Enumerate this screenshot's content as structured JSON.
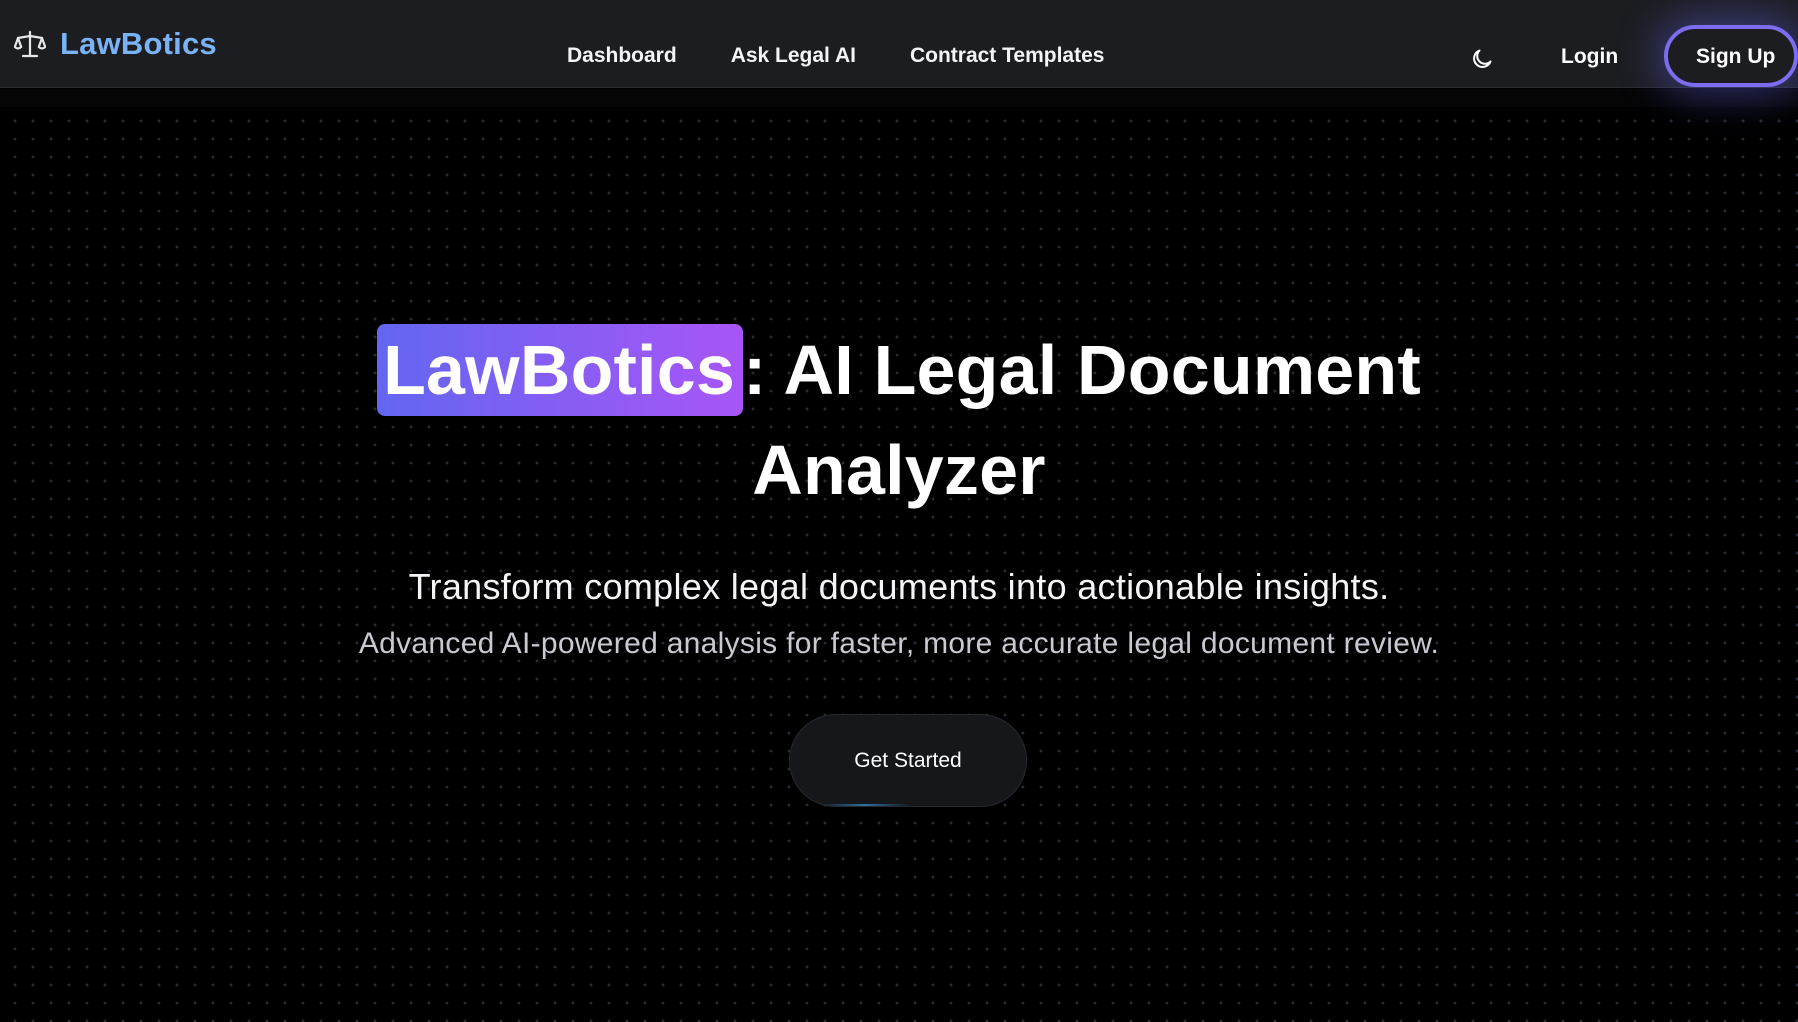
{
  "brand": {
    "name": "LawBotics",
    "icon": "scale-icon",
    "color": "#7ab3f5"
  },
  "nav": {
    "links": [
      {
        "label": "Dashboard"
      },
      {
        "label": "Ask Legal AI"
      },
      {
        "label": "Contract Templates"
      }
    ],
    "theme_toggle_icon": "moon-icon",
    "login_label": "Login",
    "signup_label": "Sign Up"
  },
  "hero": {
    "title_highlight": "LawBotics",
    "title_rest_line1": ": AI Legal Document",
    "title_line2": "Analyzer",
    "subtitle": "Transform complex legal documents into actionable insights.",
    "description": "Advanced AI-powered analysis for faster, more accurate legal document review.",
    "cta_label": "Get Started"
  },
  "colors": {
    "background": "#000000",
    "navbar": "#1c1d21",
    "accent_start": "#6366f1",
    "accent_end": "#a855f7",
    "signup_border": "#7c6cf0"
  }
}
